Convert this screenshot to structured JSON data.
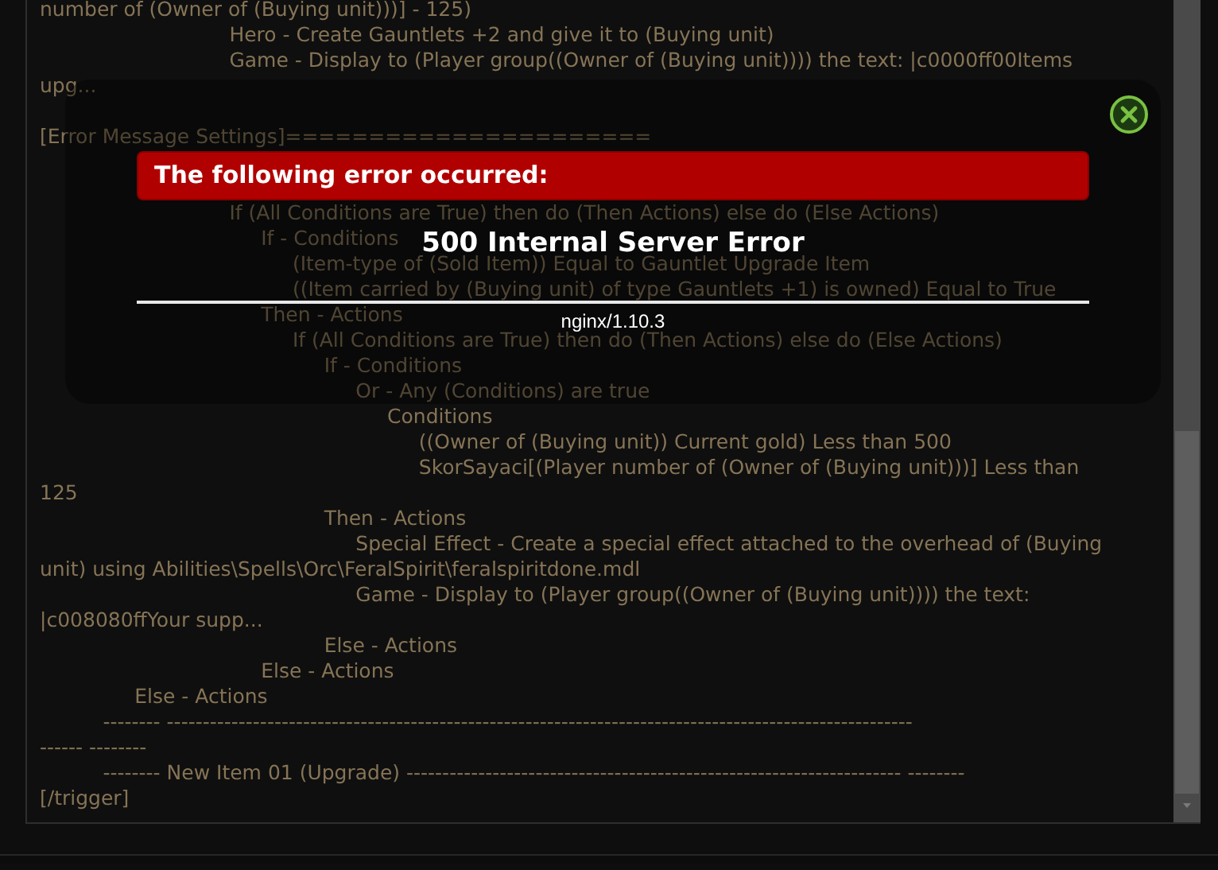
{
  "code_lines": [
    {
      "kind": "line",
      "text": "number of (Owner of (Buying unit)))] - 125)"
    },
    {
      "kind": "line",
      "text": "                              Hero - Create Gauntlets +2 and give it to (Buying unit)"
    },
    {
      "kind": "line",
      "text": "                              Game - Display to (Player group((Owner of (Buying unit)))) the text: |c0000ff00Items"
    },
    {
      "kind": "line",
      "text": "upg..."
    },
    {
      "kind": "blank"
    },
    {
      "kind": "line",
      "text": "[Error Message Settings]======================"
    },
    {
      "kind": "blank"
    },
    {
      "kind": "blank"
    },
    {
      "kind": "line",
      "text": "                              If (All Conditions are True) then do (Then Actions) else do (Else Actions)"
    },
    {
      "kind": "line",
      "text": "                                   If - Conditions"
    },
    {
      "kind": "line",
      "text": "                                        (Item-type of (Sold Item)) Equal to Gauntlet Upgrade Item"
    },
    {
      "kind": "line",
      "text": "                                        ((Item carried by (Buying unit) of type Gauntlets +1) is owned) Equal to True"
    },
    {
      "kind": "line",
      "text": "                                   Then - Actions"
    },
    {
      "kind": "line",
      "text": "                                        If (All Conditions are True) then do (Then Actions) else do (Else Actions)"
    },
    {
      "kind": "line",
      "text": "                                             If - Conditions"
    },
    {
      "kind": "line",
      "text": "                                                  Or - Any (Conditions) are true"
    },
    {
      "kind": "line",
      "text": "                                                       Conditions"
    },
    {
      "kind": "line",
      "text": "                                                            ((Owner of (Buying unit)) Current gold) Less than 500"
    },
    {
      "kind": "line",
      "text": "                                                            SkorSayaci[(Player number of (Owner of (Buying unit)))] Less than"
    },
    {
      "kind": "line",
      "text": "125"
    },
    {
      "kind": "line",
      "text": "                                             Then - Actions"
    },
    {
      "kind": "line",
      "text": "                                                  Special Effect - Create a special effect attached to the overhead of (Buying"
    },
    {
      "kind": "line",
      "text": "unit) using Abilities\\Spells\\Orc\\FeralSpirit\\feralspiritdone.mdl"
    },
    {
      "kind": "line",
      "text": "                                                  Game - Display to (Player group((Owner of (Buying unit)))) the text:"
    },
    {
      "kind": "line",
      "text": "|c008080ffYour supp..."
    },
    {
      "kind": "line",
      "text": "                                             Else - Actions"
    },
    {
      "kind": "line",
      "text": "                                   Else - Actions"
    },
    {
      "kind": "line",
      "text": "               Else - Actions"
    },
    {
      "kind": "line",
      "text": "          -------- --------------------------------------------------------------------------------------------------------"
    },
    {
      "kind": "line",
      "text": "------ --------"
    },
    {
      "kind": "line",
      "text": "          -------- New Item 01 (Upgrade) --------------------------------------------------------------------- --------"
    },
    {
      "kind": "line",
      "text": "[/trigger]"
    }
  ],
  "error_dialog": {
    "banner": "The following error occurred:",
    "title": "500 Internal Server Error",
    "server": "nginx/1.10.3"
  }
}
